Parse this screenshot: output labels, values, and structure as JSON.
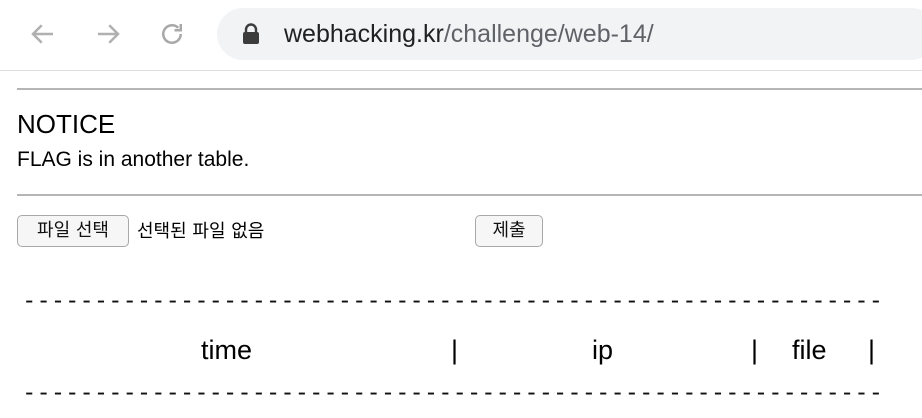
{
  "browser": {
    "url_host": "webhacking.kr",
    "url_path": "/challenge/web-14/",
    "icons": [
      "back-arrow-icon",
      "forward-arrow-icon",
      "reload-icon",
      "lock-icon"
    ]
  },
  "notice": {
    "title": "NOTICE",
    "text": "FLAG is in another table."
  },
  "upload": {
    "choose_file_label": "파일 선택",
    "file_status": "선택된 파일 없음",
    "submit_label": "제출"
  },
  "log_table": {
    "separator_line": "-------------------------------------------------------------------------------",
    "headers": [
      "time",
      "ip",
      "file"
    ],
    "column_separator": "|"
  }
}
